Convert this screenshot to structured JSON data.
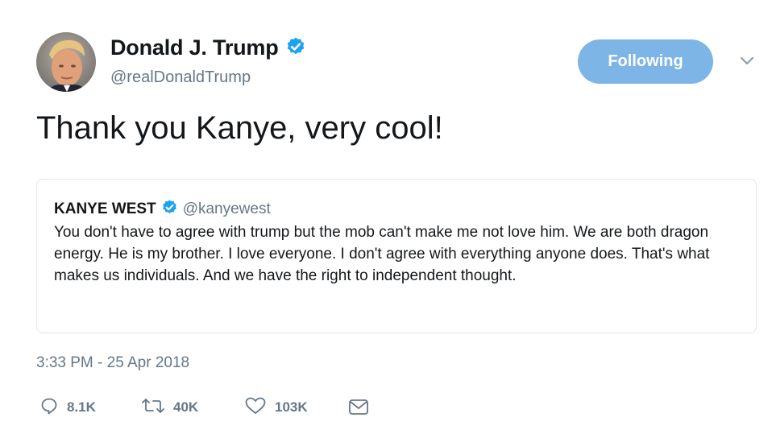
{
  "author": {
    "name": "Donald J. Trump",
    "handle": "@realDonaldTrump",
    "verified": true
  },
  "follow_button": {
    "label": "Following"
  },
  "menu_icon": "chevron-down-icon",
  "tweet": {
    "text": "Thank you Kanye, very cool!"
  },
  "quoted_tweet": {
    "name": "KANYE WEST",
    "handle": "@kanyewest",
    "verified": true,
    "text": "You don't have to agree with trump but the mob can't make me not love him. We are both dragon energy. He is my brother. I love everyone. I don't agree with everything anyone does. That's what makes us individuals. And we have the right to independent thought."
  },
  "timestamp": "3:33 PM - 25 Apr 2018",
  "actions": {
    "replies": "8.1K",
    "retweets": "40K",
    "likes": "103K"
  },
  "colors": {
    "verified": "#1da1f2",
    "follow_button": "#7cb5e6",
    "secondary_text": "#657786",
    "border": "#e1e8ed"
  }
}
